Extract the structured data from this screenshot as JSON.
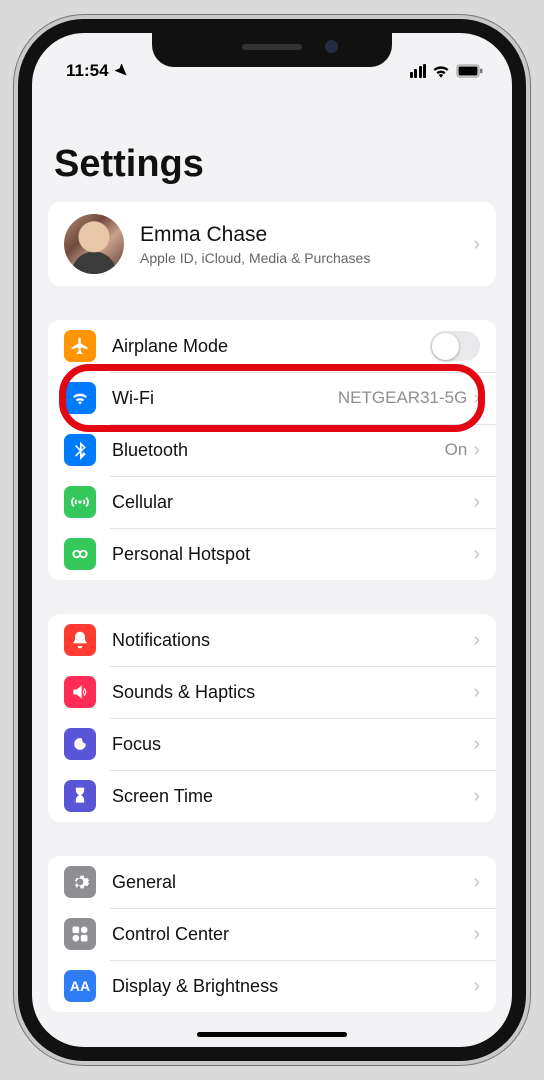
{
  "status": {
    "time": "11:54"
  },
  "title": "Settings",
  "profile": {
    "name": "Emma Chase",
    "subtitle": "Apple ID, iCloud, Media & Purchases"
  },
  "groups": {
    "connectivity": {
      "airplane": "Airplane Mode",
      "wifi": "Wi-Fi",
      "wifi_detail": "NETGEAR31-5G",
      "bluetooth": "Bluetooth",
      "bluetooth_detail": "On",
      "cellular": "Cellular",
      "hotspot": "Personal Hotspot"
    },
    "notifications": {
      "notifications": "Notifications",
      "sounds": "Sounds & Haptics",
      "focus": "Focus",
      "screen_time": "Screen Time"
    },
    "general": {
      "general": "General",
      "control_center": "Control Center",
      "display": "Display & Brightness"
    }
  }
}
